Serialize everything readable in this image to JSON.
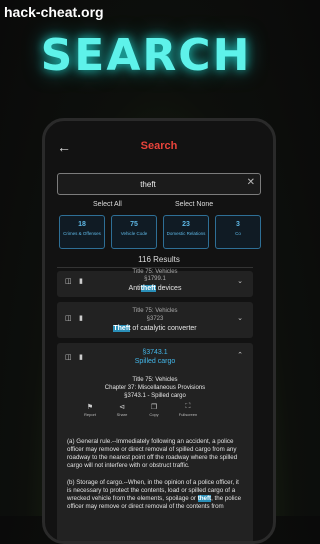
{
  "watermark": "hack-cheat.org",
  "headline": "SEARCH",
  "app": {
    "title": "Search",
    "search_value": "theft",
    "select_all": "Select All",
    "select_none": "Select None",
    "chips": [
      {
        "count": "18",
        "label": "Crimes & Offenses"
      },
      {
        "count": "75",
        "label": "Vehicle Code"
      },
      {
        "count": "23",
        "label": "Domestic Relations"
      },
      {
        "count": "3",
        "label": "Co"
      }
    ],
    "result_count": "116 Results"
  },
  "results": [
    {
      "title": "Title 75: Vehicles",
      "section": "§1799.1",
      "heading_pre": "Anti",
      "heading_hl": "theft",
      "heading_post": " devices"
    },
    {
      "title": "Title 75: Vehicles",
      "section": "§3723",
      "heading_pre": "",
      "heading_hl": "Theft",
      "heading_post": " of catalytic converter"
    }
  ],
  "expanded": {
    "section_line": "§3743.1",
    "heading": "Spilled cargo",
    "meta": [
      "Title 75: Vehicles",
      "Chapter 37: Miscellaneous Provisions",
      "§3743.1 - Spilled cargo"
    ],
    "actions": [
      "Report",
      "Share",
      "Copy",
      "Fullscreen"
    ],
    "para_a": "(a)  General rule.--Immediately following an accident, a police officer may remove or direct removal of spilled cargo from any roadway to the nearest point off the roadway where the spilled cargo will not interfere with or obstruct traffic.",
    "para_b_pre": "(b)  Storage of cargo.--When, in the opinion of a police officer, it is necessary to protect the contents, load or spilled cargo of a wrecked vehicle from the elements, spoilage or ",
    "para_b_hl": "theft",
    "para_b_post": ", the police officer may remove or direct removal of the contents from"
  }
}
